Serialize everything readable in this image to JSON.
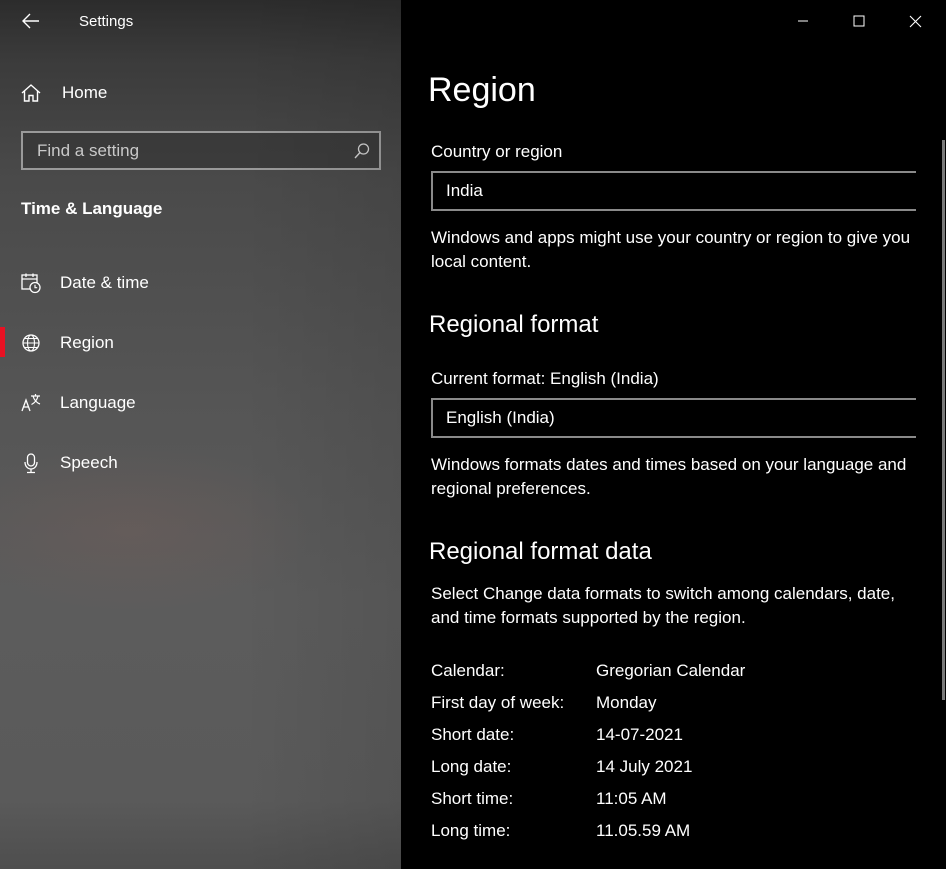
{
  "window": {
    "title": "Settings",
    "controls": {
      "minimize": "—",
      "maximize": "☐",
      "close": "✕"
    }
  },
  "sidebar": {
    "home_label": "Home",
    "search_placeholder": "Find a setting",
    "section_title": "Time & Language",
    "items": [
      {
        "label": "Date & time",
        "icon": "calendar-clock-icon",
        "selected": false
      },
      {
        "label": "Region",
        "icon": "globe-icon",
        "selected": true
      },
      {
        "label": "Language",
        "icon": "language-icon",
        "selected": false
      },
      {
        "label": "Speech",
        "icon": "microphone-icon",
        "selected": false
      }
    ],
    "accent_color": "#e81123"
  },
  "main": {
    "page_title": "Region",
    "country": {
      "label": "Country or region",
      "value": "India",
      "description": "Windows and apps might use your country or region to give you local content."
    },
    "regional_format": {
      "heading": "Regional format",
      "current_label": "Current format: English (India)",
      "value": "English (India)",
      "description": "Windows formats dates and times based on your language and regional preferences."
    },
    "regional_format_data": {
      "heading": "Regional format data",
      "description": "Select Change data formats to switch among calendars, date, and time formats supported by the region.",
      "rows": [
        {
          "key": "Calendar:",
          "value": "Gregorian Calendar"
        },
        {
          "key": "First day of week:",
          "value": "Monday"
        },
        {
          "key": "Short date:",
          "value": "14-07-2021"
        },
        {
          "key": "Long date:",
          "value": "14 July 2021"
        },
        {
          "key": "Short time:",
          "value": "11:05 AM"
        },
        {
          "key": "Long time:",
          "value": "11.05.59 AM"
        }
      ]
    }
  }
}
